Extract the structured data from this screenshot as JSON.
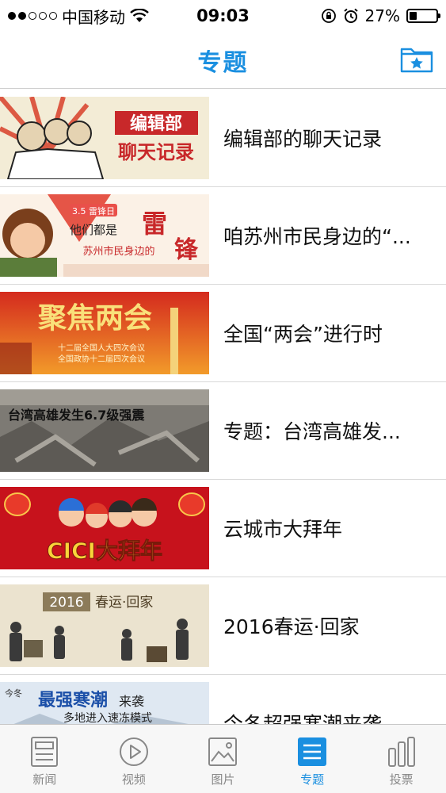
{
  "status_bar": {
    "carrier": "中国移动",
    "time": "09:03",
    "battery": "27%",
    "battery_level": 0.27,
    "signal_bars": 2,
    "signal_total": 5
  },
  "nav": {
    "title": "专题",
    "accent_color": "#1a8fe0"
  },
  "topics": [
    {
      "title": "编辑部的聊天记录",
      "thumb_text": [
        "编辑部",
        "聊天记录"
      ]
    },
    {
      "title": "咱苏州市民身边的“...",
      "thumb_text": [
        "3.5 雷锋日",
        "他们都是",
        "苏州市民身边的",
        "雷",
        "锋"
      ]
    },
    {
      "title": "全国“两会”进行时",
      "thumb_text": [
        "聚焦两会",
        "十二届全国人大四次会议",
        "全国政协十二届四次会议"
      ]
    },
    {
      "title": "专题：台湾高雄发...",
      "thumb_text": [
        "台湾高雄发生6.7级强震"
      ]
    },
    {
      "title": "云城市大拜年",
      "thumb_text": [
        "CICI大拜年"
      ]
    },
    {
      "title": "2016春运·回家",
      "thumb_text": [
        "2016",
        "春运·回家"
      ]
    },
    {
      "title": "今冬超强寒潮来袭",
      "thumb_text": [
        "今冬",
        "最强寒潮",
        "来袭",
        "多地进入速冻模式"
      ]
    }
  ],
  "tabs": [
    {
      "label": "新闻",
      "icon": "news-icon",
      "active": false
    },
    {
      "label": "视频",
      "icon": "video-play-icon",
      "active": false
    },
    {
      "label": "图片",
      "icon": "picture-icon",
      "active": false
    },
    {
      "label": "专题",
      "icon": "topics-list-icon",
      "active": true
    },
    {
      "label": "投票",
      "icon": "poll-bars-icon",
      "active": false
    }
  ]
}
